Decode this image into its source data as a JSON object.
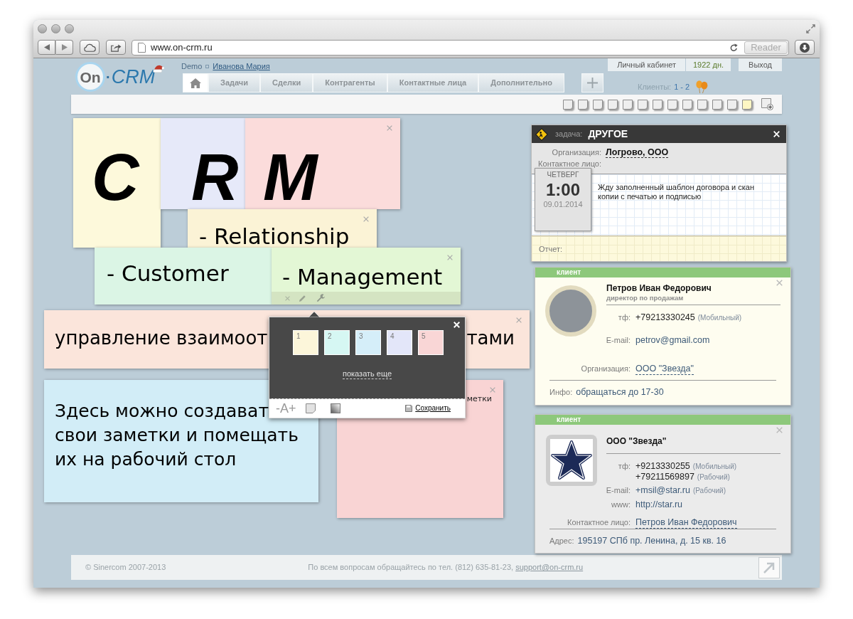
{
  "browser": {
    "url": "www.on-crm.ru",
    "reader": "Reader"
  },
  "header": {
    "logo": {
      "left": "On",
      "dot": "·",
      "right": "CRM"
    },
    "account": "Demo",
    "user": "Иванова Мария",
    "tabs": [
      {
        "kind": "home",
        "selected": true
      },
      {
        "kind": "text",
        "label": "Задачи",
        "selected": false
      },
      {
        "kind": "text",
        "label": "Сделки",
        "selected": false
      },
      {
        "kind": "text",
        "label": "Контрагенты",
        "selected": false
      },
      {
        "kind": "text",
        "label": "Контактные лица",
        "selected": false
      },
      {
        "kind": "text",
        "label": "Дополнительно",
        "selected": false
      }
    ],
    "links": [
      {
        "kind": "link",
        "label": "Личный кабинет"
      },
      {
        "kind": "counter",
        "label": "1922 дн."
      },
      {
        "kind": "link",
        "label": "Выход"
      }
    ],
    "clients_label": "Клиенты:",
    "clients_range": "1 - 2"
  },
  "note_icons": [
    {
      "color": "#eeeeee"
    },
    {
      "color": "#eeeeee"
    },
    {
      "color": "#eeeeee"
    },
    {
      "color": "#eeeeee"
    },
    {
      "color": "#eeeeee"
    },
    {
      "color": "#eeeeee"
    },
    {
      "color": "#eeeeee"
    },
    {
      "color": "#eeeeee"
    },
    {
      "color": "#eeeeee"
    },
    {
      "color": "#eeeeee"
    },
    {
      "color": "#eeeeee"
    },
    {
      "color": "#eeeeee"
    },
    {
      "color": "#fdf6c3"
    }
  ],
  "notes": [
    {
      "kind": "letter",
      "text": "C",
      "color": "#fdf9db",
      "closable": false,
      "active": false
    },
    {
      "kind": "letter",
      "text": "R",
      "color": "#e6e9f9",
      "closable": false,
      "active": false
    },
    {
      "kind": "letter",
      "text": "M",
      "color": "#fbdcdb",
      "closable": true,
      "active": false
    },
    {
      "kind": "text",
      "text": "- Relationship",
      "color": "#fbf3d6",
      "closable": true,
      "active": false
    },
    {
      "kind": "text",
      "text": "- Customer",
      "color": "#dbf5e5",
      "closable": false,
      "active": false
    },
    {
      "kind": "text",
      "text": "- Management",
      "color": "#e3f7d5",
      "closable": true,
      "active": true
    },
    {
      "kind": "split",
      "parts": [
        "управление взаимоот",
        "тами"
      ],
      "color": "#fbe5db",
      "closable": true,
      "active": false
    },
    {
      "kind": "lines",
      "lines": [
        "Здесь можно создават",
        "свои заметки и помещать",
        "их на рабочий стол"
      ],
      "color": "#d2edf7",
      "closable": false,
      "active": false
    },
    {
      "kind": "small",
      "text": "метки",
      "color": "#f9d4d4",
      "closable": true,
      "active": false
    }
  ],
  "note_editor": {
    "swatches": [
      {
        "label": "1",
        "color": "#fcf6da"
      },
      {
        "label": "2",
        "color": "#d6f7f3"
      },
      {
        "label": "3",
        "color": "#d5eef9"
      },
      {
        "label": "4",
        "color": "#e3e6f9"
      },
      {
        "label": "5",
        "color": "#f9d6d6"
      }
    ],
    "more": "показать еще",
    "font_size": "-A+",
    "save": "Сохранить"
  },
  "task": {
    "type_label": "задача:",
    "title": "ДРУГОЕ",
    "org_label": "Организация:",
    "org": "Логрово, ООО",
    "contact_label": "Контактное лицо:",
    "weekday": "ЧЕТВЕРГ",
    "time": "1:00",
    "date": "09.01.2014",
    "description": "Жду заполненный шаблон договора и скан копии с печатью и подписью",
    "report_label": "Отчет:"
  },
  "clients": [
    {
      "kind": "person",
      "badge": "клиент",
      "name": "Петров Иван Федорович",
      "position": "директор по продажам",
      "fields": [
        {
          "label": "тф:",
          "values": [
            {
              "kind": "phone",
              "text": "+79213330245",
              "note": "(Мобильный)"
            }
          ]
        },
        {
          "label": "E-mail:",
          "values": [
            {
              "kind": "email",
              "text": "petrov@gmail.com"
            }
          ]
        },
        {
          "label": "Организация:",
          "values": [
            {
              "kind": "link",
              "text": "ООО \"Звезда\""
            }
          ]
        }
      ],
      "extra_label": "Инфо:",
      "extra": "обращаться до 17-30"
    },
    {
      "kind": "company",
      "badge": "клиент",
      "name": "ООО \"Звезда\"",
      "fields": [
        {
          "label": "тф:",
          "values": [
            {
              "kind": "phone",
              "text": "+9213330255",
              "note": "(Мобильный)"
            },
            {
              "kind": "phone",
              "text": "+79211569897",
              "note": "(Рабочий)"
            }
          ]
        },
        {
          "label": "E-mail:",
          "values": [
            {
              "kind": "email",
              "text": "+msil@star.ru",
              "note": "(Рабочий)"
            }
          ]
        },
        {
          "label": "www:",
          "values": [
            {
              "kind": "url",
              "text": "http://star.ru"
            }
          ]
        },
        {
          "label": "Контактное лицо:",
          "values": [
            {
              "kind": "link",
              "text": "Петров Иван Федорович"
            }
          ]
        }
      ],
      "extra_label": "Адрес:",
      "extra": "195197 СПб пр. Ленина, д. 15 кв. 16"
    }
  ],
  "footer": {
    "copyright": "© Sinercom 2007-2013",
    "contact": "По всем вопросам обращайтесь по тел. (812) 635-81-23,",
    "email": "support@on-crm.ru"
  }
}
